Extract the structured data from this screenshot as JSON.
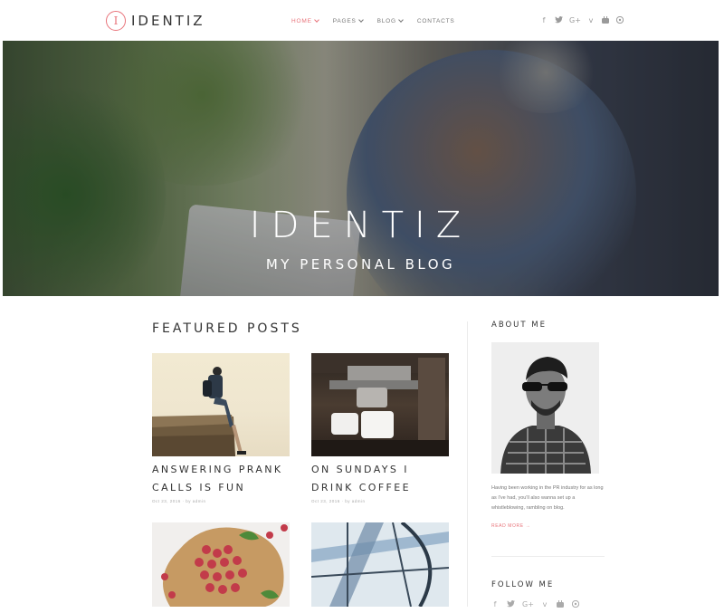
{
  "header": {
    "logo_mark": "I",
    "logo_text": "IDENTIZ",
    "nav": [
      {
        "label": "HOME",
        "has_dropdown": true,
        "active": true
      },
      {
        "label": "PAGES",
        "has_dropdown": true,
        "active": false
      },
      {
        "label": "BLOG",
        "has_dropdown": true,
        "active": false
      },
      {
        "label": "CONTACTS",
        "has_dropdown": false,
        "active": false
      }
    ],
    "social": [
      "facebook-icon",
      "twitter-icon",
      "google-plus-icon",
      "vimeo-icon",
      "youtube-icon",
      "pinterest-icon"
    ]
  },
  "hero": {
    "title": "IDENTIZ",
    "subtitle": "MY PERSONAL BLOG"
  },
  "featured": {
    "title": "FEATURED POSTS",
    "posts": [
      {
        "title": "ANSWERING PRANK CALLS IS FUN",
        "meta": "Oct 23, 2016 · by admin"
      },
      {
        "title": "ON SUNDAYS I DRINK COFFEE",
        "meta": "Oct 23, 2016 · by admin"
      }
    ]
  },
  "sidebar": {
    "about_title": "ABOUT ME",
    "about_text": "Having been working in the PR industry for as long as I've had, you'll also wanna set up a whistleblowing, rambling on blog.",
    "read_more": "READ MORE →",
    "follow_title": "FOLLOW ME"
  },
  "colors": {
    "accent": "#e8737a",
    "text": "#333333",
    "muted": "#9a9a9a"
  }
}
